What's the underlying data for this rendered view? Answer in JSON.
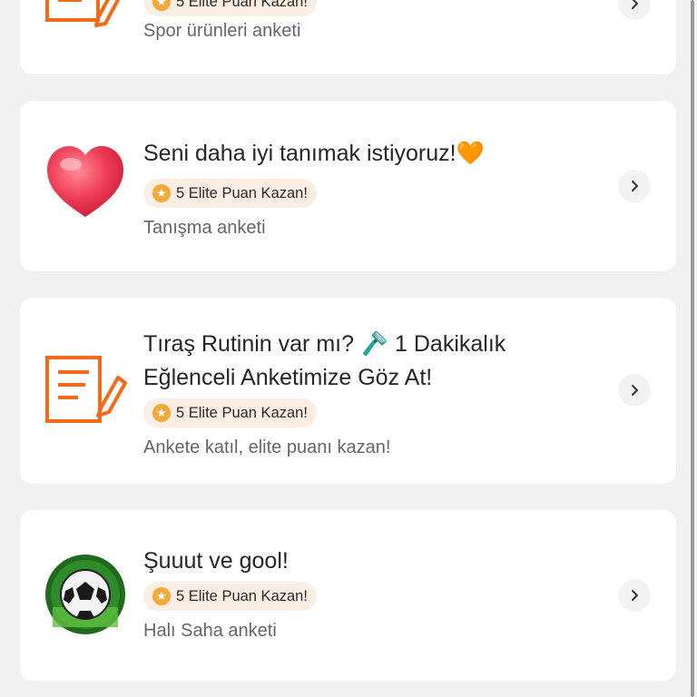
{
  "cards": [
    {
      "title_lines": [
        ""
      ],
      "badge": "5 Elite Puan Kazan!",
      "subtitle": "Spor ürünleri anketi",
      "icon": "survey-form-icon"
    },
    {
      "title_lines": [
        "Seni daha iyi tanımak istiyoruz!🧡"
      ],
      "badge": "5 Elite Puan Kazan!",
      "subtitle": "Tanışma anketi",
      "icon": "heart-icon"
    },
    {
      "title_lines": [
        "Tıraş Rutinin var mı? 🪒 1 Dakikalık",
        "Eğlenceli Anketimize Göz At!"
      ],
      "badge": "5 Elite Puan Kazan!",
      "subtitle": "Ankete katıl, elite puanı kazan!",
      "icon": "survey-form-icon"
    },
    {
      "title_lines": [
        "Şuuut ve gool!"
      ],
      "badge": "5 Elite Puan Kazan!",
      "subtitle": "Halı Saha anketi",
      "icon": "soccer-ball-icon"
    }
  ],
  "colors": {
    "accent": "#f26a1b",
    "badge_bg": "#fdeee3",
    "star": "#f3a93a",
    "page_bg": "#f1f1f2"
  }
}
